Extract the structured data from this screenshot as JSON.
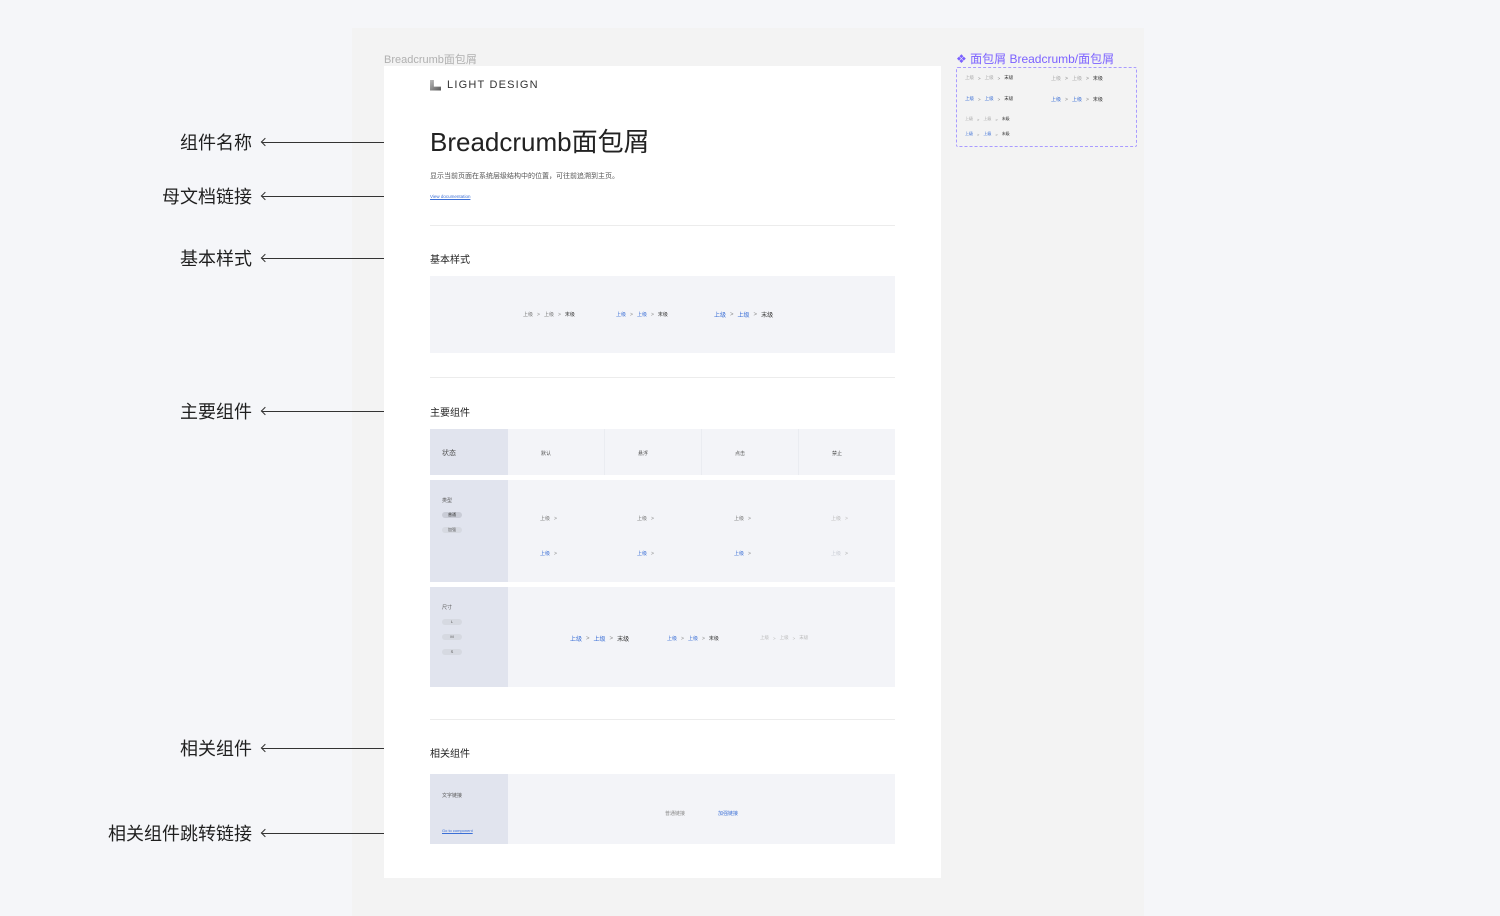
{
  "annotations": [
    {
      "label": "组件名称"
    },
    {
      "label": "母文档链接"
    },
    {
      "label": "基本样式"
    },
    {
      "label": "主要组件"
    },
    {
      "label": "相关组件"
    },
    {
      "label": "相关组件跳转链接"
    }
  ],
  "frame": {
    "label": "Breadcrumb面包屑",
    "logo_text": "LIGHT DESIGN",
    "title": "Breadcrumb面包屑",
    "description": "显示当前页面在系统层级结构中的位置，可往前追溯到主页。",
    "doc_link": "View documentation"
  },
  "crumb": {
    "parent": "上级",
    "current": "末级",
    "separator": ">"
  },
  "basic": {
    "title": "基本样式"
  },
  "main": {
    "title": "主要组件",
    "state_header": "状态",
    "states": [
      "默认",
      "悬浮",
      "点击",
      "禁止"
    ],
    "type_label": "类型",
    "type_pills": [
      "普通",
      "加强"
    ],
    "size_label": "尺寸",
    "size_pills": [
      "L",
      "M",
      "S"
    ]
  },
  "related": {
    "title": "相关组件",
    "item_label": "文字链接",
    "goto_link": "Go to component",
    "normal_link": "普通链接",
    "strong_link": "加强链接"
  },
  "component": {
    "title": "面包屑 Breadcrumb/面包屑",
    "icon": "component-diamond-icon",
    "accent": "#7b61ff"
  },
  "colors": {
    "link": "#3b6fd6",
    "panel": "#f3f4f8",
    "header": "#e1e4ee"
  }
}
